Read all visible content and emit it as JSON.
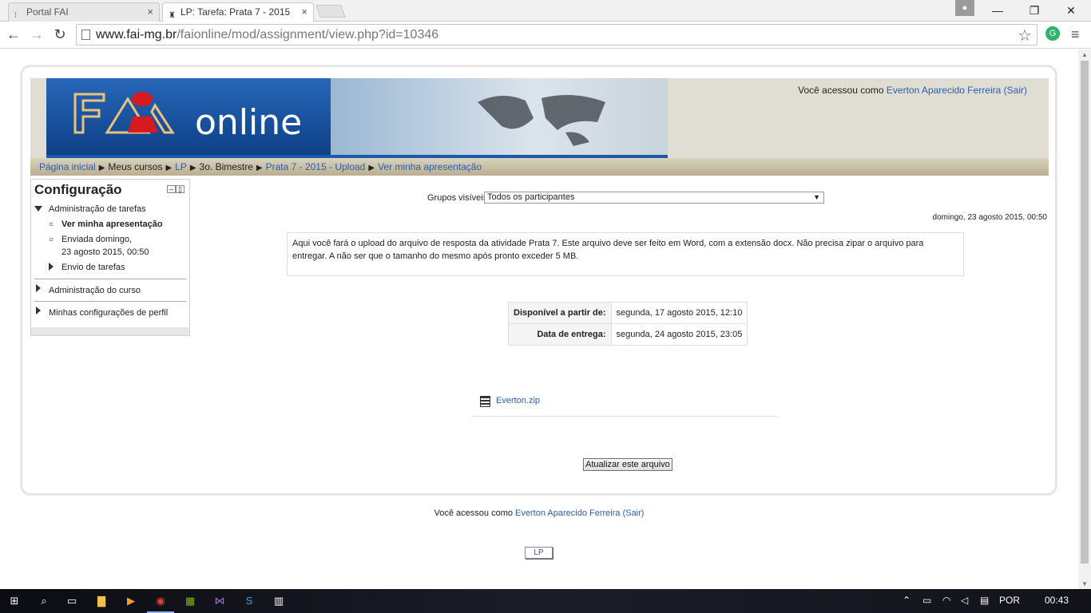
{
  "browser": {
    "tabs": [
      {
        "title": "Portal FAI",
        "active": false
      },
      {
        "title": "LP: Tarefa: Prata 7 - 2015 -",
        "active": true
      }
    ],
    "url_domain": "www.fai-mg.br",
    "url_path": "/faionline/mod/assignment/view.php?id=10346"
  },
  "header": {
    "logo_text": "online",
    "login_prefix": "Você acessou como",
    "user_name": "Everton Aparecido Ferreira",
    "logout_label": "(Sair)"
  },
  "breadcrumb": [
    {
      "label": "Página inicial",
      "link": true
    },
    {
      "label": "Meus cursos",
      "link": false
    },
    {
      "label": "LP",
      "link": true
    },
    {
      "label": "3o. Bimestre",
      "link": false
    },
    {
      "label": "Prata 7 - 2015 - Upload",
      "link": true
    },
    {
      "label": "Ver minha apresentação",
      "link": true
    }
  ],
  "config_block": {
    "title": "Configuração",
    "section_assign": "Administração de tarefas",
    "view_submission": "Ver minha apresentação",
    "sent_line1": "Enviada domingo,",
    "sent_line2": "23 agosto 2015, 00:50",
    "submissions": "Envio de tarefas",
    "course_admin": "Administração do curso",
    "profile_settings": "Minhas configurações de perfil"
  },
  "main": {
    "groups_label": "Grupos visíveis",
    "groups_value": "Todos os participantes",
    "timestamp": "domingo, 23 agosto 2015, 00:50",
    "intro_text": "Aqui você fará o upload do arquivo de resposta da atividade Prata 7. Este arquivo deve ser feito em Word, com a extensão docx. Não precisa zipar o arquivo para entregar. A não ser que o tamanho do mesmo após pronto exceder 5 MB.",
    "dates": [
      {
        "label": "Disponível a partir de:",
        "value": "segunda, 17 agosto 2015, 12:10"
      },
      {
        "label": "Data de entrega:",
        "value": "segunda, 24 agosto 2015, 23:05"
      }
    ],
    "file_name": "Everton.zip",
    "update_button": "Atualizar este arquivo"
  },
  "footer": {
    "login_prefix": "Você acessou como",
    "user_name": "Everton Aparecido Ferreira",
    "logout_label": "(Sair)",
    "home_link": "LP"
  },
  "taskbar": {
    "language": "POR",
    "time": "00:43"
  },
  "colors": {
    "link": "#2a5db0",
    "breadcrumb_bar": "#c9c0a6",
    "banner_blue": "#1a5aa8",
    "header_bg": "#e0ddd3"
  }
}
